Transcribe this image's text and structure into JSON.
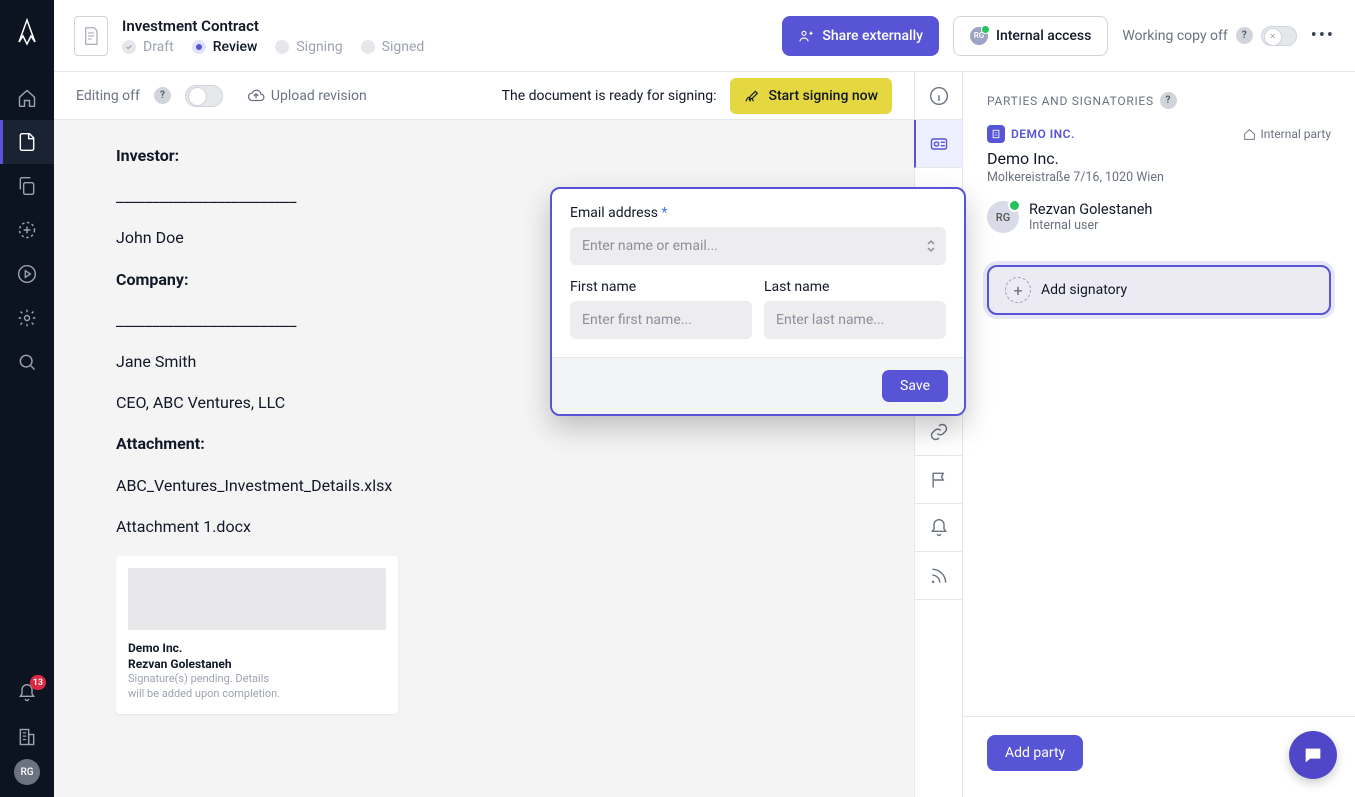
{
  "header": {
    "doc_title": "Investment Contract",
    "statuses": {
      "draft": "Draft",
      "review": "Review",
      "signing": "Signing",
      "signed": "Signed"
    },
    "share_label": "Share externally",
    "internal_access_label": "Internal access",
    "internal_access_avatar": "RG",
    "working_copy_label": "Working copy off"
  },
  "toolbar": {
    "editing_label": "Editing off",
    "upload_label": "Upload revision",
    "ready_text": "The document is ready for signing:",
    "start_signing_label": "Start signing now"
  },
  "doc": {
    "investor_label": "Investor:",
    "blank1": "_________________________",
    "john": "John Doe",
    "company_label": "Company:",
    "blank2": "_________________________",
    "jane": "Jane Smith",
    "ceo": "CEO, ABC Ventures, LLC",
    "attachment_label": "Attachment:",
    "attach1": "ABC_Ventures_Investment_Details.xlsx",
    "attach2": "Attachment 1.docx"
  },
  "signature_card": {
    "company": "Demo Inc.",
    "name": "Rezvan Golestaneh",
    "pending1": "Signature(s) pending. Details",
    "pending2": "will be added upon completion."
  },
  "right_panel": {
    "title": "PARTIES AND SIGNATORIES",
    "party_tag": "DEMO INC.",
    "internal_party_label": "Internal party",
    "party_name": "Demo Inc.",
    "party_addr": "Molkereistraße 7/16, 1020 Wien",
    "user_avatar": "RG",
    "user_name": "Rezvan Golestaneh",
    "user_role": "Internal user",
    "add_signatory_label": "Add signatory",
    "add_party_label": "Add party"
  },
  "modal": {
    "email_label": "Email address",
    "email_placeholder": "Enter name or email...",
    "first_name_label": "First name",
    "first_name_placeholder": "Enter first name...",
    "last_name_label": "Last name",
    "last_name_placeholder": "Enter last name...",
    "save_label": "Save"
  },
  "rail": {
    "notif_count": "13",
    "avatar": "RG"
  }
}
